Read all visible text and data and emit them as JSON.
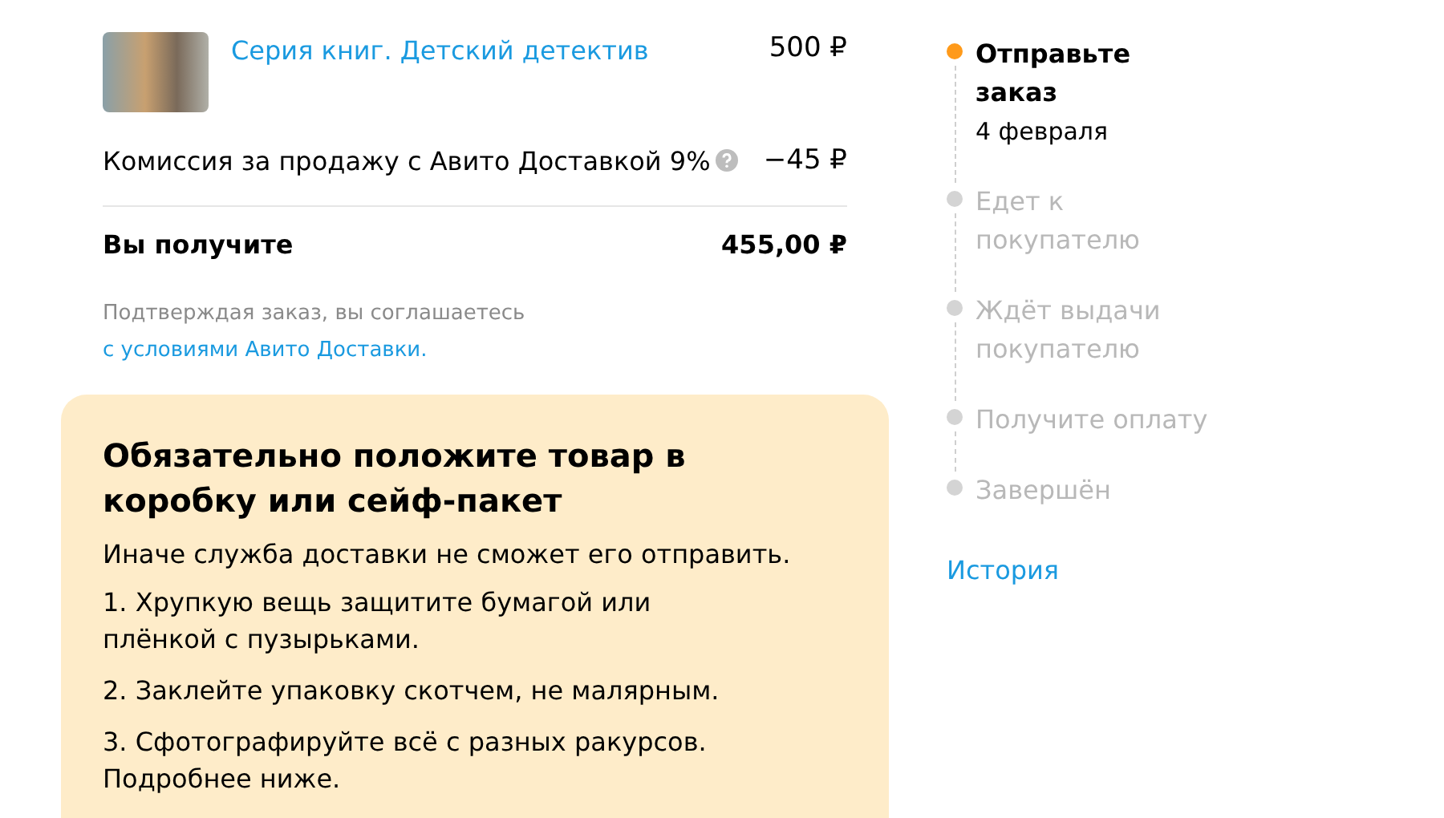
{
  "order": {
    "item": {
      "title": "Серия книг. Детский детектив",
      "price": "500 ₽"
    },
    "fee": {
      "label": "Комиссия за продажу с Авито Доставкой 9%",
      "amount": "−45 ₽"
    },
    "total": {
      "label": "Вы получите",
      "amount": "455,00 ₽"
    },
    "terms": {
      "text": "Подтверждая заказ, вы соглашаетесь",
      "link": "с условиями Авито Доставки."
    }
  },
  "notice": {
    "title": "Обязательно положите товар в коробку или сейф-пакет",
    "subtitle": "Иначе служба доставки не сможет его отправить.",
    "items": [
      "1. Хрупкую вещь защитите бумагой или плёнкой с пузырьками.",
      "2. Заклейте упаковку скотчем, не малярным.",
      "3. Сфотографируйте всё с разных ракурсов. Подробнее ниже."
    ]
  },
  "steps": [
    {
      "label": "Отправьте заказ",
      "date": "4 февраля",
      "current": true
    },
    {
      "label": "Едет к покупателю",
      "current": false
    },
    {
      "label": "Ждёт выдачи покупателю",
      "current": false
    },
    {
      "label": "Получите оплату",
      "current": false
    },
    {
      "label": "Завершён",
      "current": false
    }
  ],
  "history_link": "История"
}
